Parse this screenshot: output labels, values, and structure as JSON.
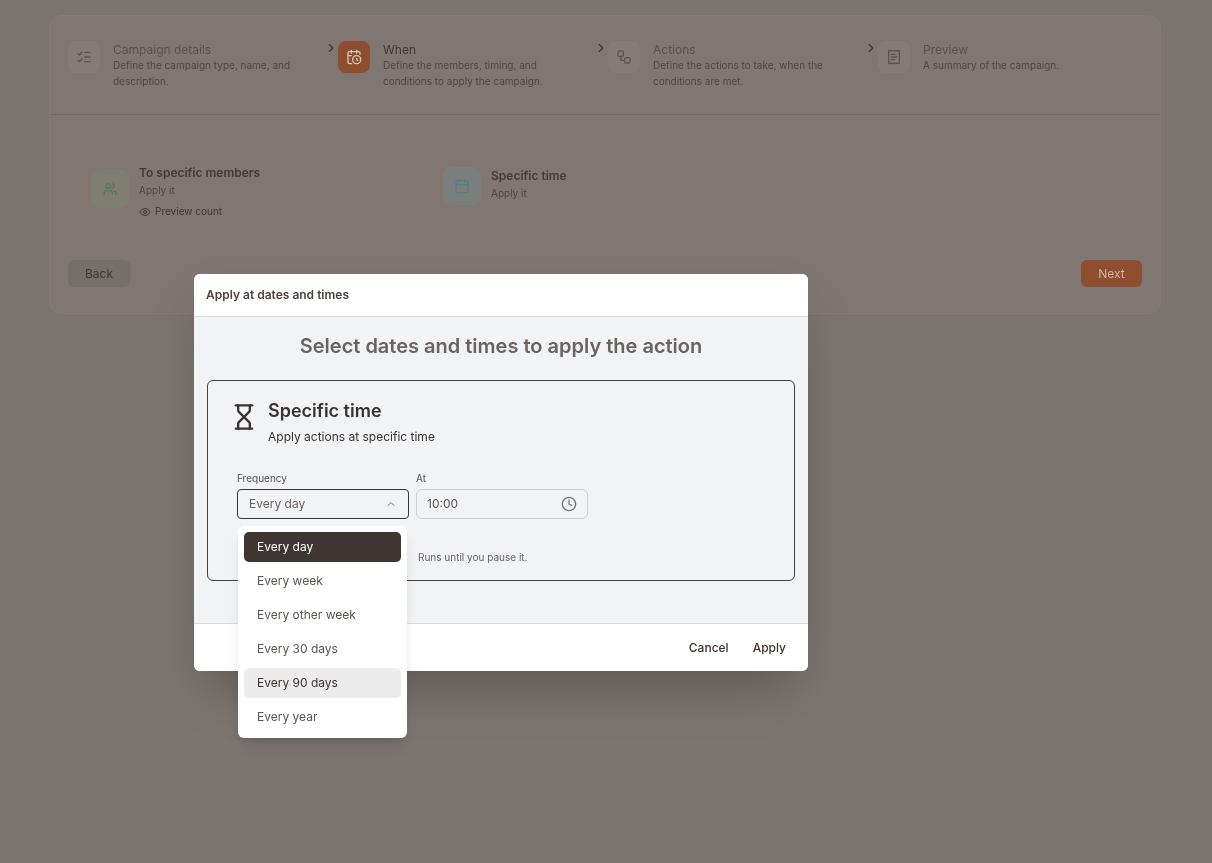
{
  "steps": [
    {
      "kind": "list",
      "title": "Campaign details",
      "description": "Define the campaign type, name, and description.",
      "selected": false
    },
    {
      "kind": "calendar",
      "title": "When",
      "description": "Define the members, timing, and conditions to apply the campaign.",
      "selected": true
    },
    {
      "kind": "flow",
      "title": "Actions",
      "description": "Define the actions to take, when the conditions are met.",
      "selected": false
    },
    {
      "kind": "receipt",
      "title": "Preview",
      "description": "A summary of the campaign.",
      "selected": false
    }
  ],
  "options": [
    {
      "kind": "members",
      "title": "To specific members",
      "subtitle": "Apply it",
      "link": "Preview count"
    },
    {
      "kind": "time",
      "title": "Specific time",
      "subtitle": "Apply it"
    }
  ],
  "back_button": "Back",
  "next_button": "Next",
  "dialog": {
    "title": "Apply at dates and times",
    "heading": "Select dates and times to apply the action",
    "card_title": "Specific time",
    "card_subtitle": "Apply actions at specific time",
    "frequency_label": "Frequency",
    "frequency_value": "Every day",
    "at_label": "At",
    "at_value": "10:00",
    "note": "Runs until you pause it.",
    "menu": [
      {
        "label": "Every day",
        "selected": true,
        "highlighted": false
      },
      {
        "label": "Every week",
        "selected": false,
        "highlighted": false
      },
      {
        "label": "Every other week",
        "selected": false,
        "highlighted": false
      },
      {
        "label": "Every 30 days",
        "selected": false,
        "highlighted": false
      },
      {
        "label": "Every 90 days",
        "selected": false,
        "highlighted": true
      },
      {
        "label": "Every year",
        "selected": false,
        "highlighted": false
      }
    ],
    "cancel": "Cancel",
    "apply": "Apply"
  }
}
